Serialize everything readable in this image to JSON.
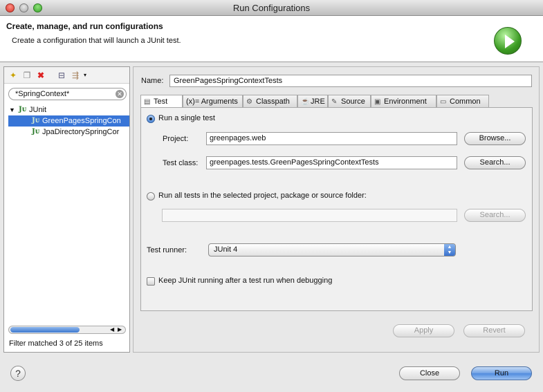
{
  "window": {
    "title": "Run Configurations"
  },
  "banner": {
    "title": "Create, manage, and run configurations",
    "subtitle": "Create a configuration that will launch a JUnit test.",
    "icon": "run-icon"
  },
  "left_panel": {
    "toolbar": [
      "new-config-icon",
      "duplicate-icon",
      "delete-icon",
      "collapse-all-icon",
      "filter-icon"
    ],
    "filter_value": "*SpringContext*",
    "tree": {
      "category": {
        "label": "JUnit",
        "icon": "junit-icon"
      },
      "items": [
        {
          "label": "GreenPagesSpringCon",
          "selected": true,
          "icon": "junit-launch-icon"
        },
        {
          "label": "JpaDirectorySpringCor",
          "selected": false,
          "icon": "junit-launch-icon"
        }
      ]
    },
    "status": "Filter matched 3 of 25 items"
  },
  "config": {
    "name_label": "Name:",
    "name_value": "GreenPagesSpringContextTests",
    "tabs": [
      {
        "label": "Test",
        "icon": "test-icon",
        "active": true
      },
      {
        "label": "Arguments",
        "icon": "arguments-icon",
        "prefix": "(x)="
      },
      {
        "label": "Classpath",
        "icon": "classpath-icon"
      },
      {
        "label": "JRE",
        "icon": "jre-icon"
      },
      {
        "label": "Source",
        "icon": "source-icon"
      },
      {
        "label": "Environment",
        "icon": "environment-icon"
      },
      {
        "label": "Common",
        "icon": "common-icon"
      }
    ],
    "test_tab": {
      "single_test_label": "Run a single test",
      "single_test_selected": true,
      "project_label": "Project:",
      "project_value": "greenpages.web",
      "browse_label": "Browse...",
      "test_class_label": "Test class:",
      "test_class_value": "greenpages.tests.GreenPagesSpringContextTests",
      "search_label": "Search...",
      "all_tests_label": "Run all tests in the selected project, package or source folder:",
      "all_tests_selected": false,
      "container_value": "",
      "search2_label": "Search...",
      "runner_label": "Test runner:",
      "runner_value": "JUnit 4",
      "keep_running_label": "Keep JUnit running after a test run when debugging",
      "keep_running_checked": false
    },
    "apply_label": "Apply",
    "revert_label": "Revert"
  },
  "footer": {
    "help_icon": "help-icon",
    "close_label": "Close",
    "run_label": "Run"
  }
}
